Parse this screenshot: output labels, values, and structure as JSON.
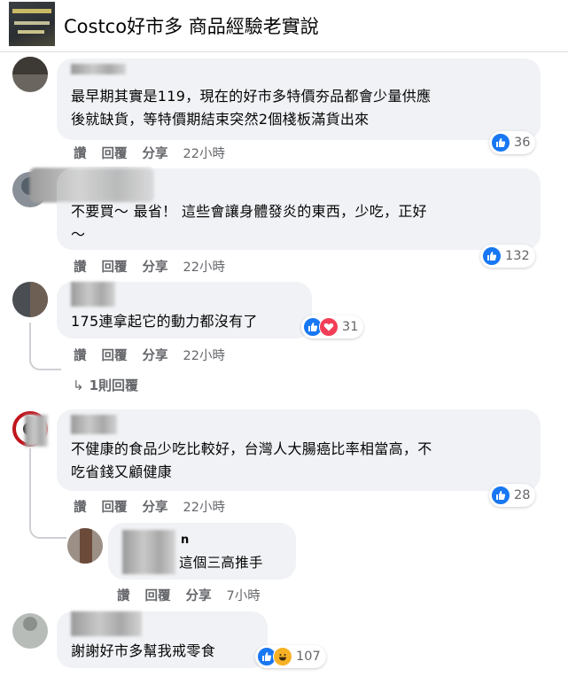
{
  "group": {
    "title": "Costco好市多 商品經驗老實說"
  },
  "actions": {
    "like": "讚",
    "reply": "回覆",
    "share": "分享"
  },
  "comments": [
    {
      "text_lines": [
        "最早期其實是119，現在的好市多特價夯品都會少量供應",
        "後就缺貨，等特價期結束突然2個棧板滿貨出來"
      ],
      "time": "22小時",
      "reactions": [
        "like"
      ],
      "count": "36"
    },
    {
      "text_lines": [
        "不要買～ 最省！ 這些會讓身體發炎的東西，少吃，正好",
        "～"
      ],
      "time": "22小時",
      "reactions": [
        "like"
      ],
      "count": "132"
    },
    {
      "text_lines": [
        "175連拿起它的動力都沒有了"
      ],
      "time": "22小時",
      "reactions": [
        "like",
        "love"
      ],
      "count": "31",
      "replies_link": "1則回覆"
    },
    {
      "text_lines": [
        "不健康的食品少吃比較好，台灣人大腸癌比率相當高，不",
        "吃省錢又顧健康"
      ],
      "time": "22小時",
      "reactions": [
        "like"
      ],
      "count": "28"
    },
    {
      "author": "n",
      "text_lines": [
        "這個三高推手"
      ],
      "time": "7小時"
    },
    {
      "text_lines": [
        "謝謝好市多幫我戒零食"
      ],
      "reactions": [
        "like",
        "haha"
      ],
      "count": "107"
    }
  ]
}
